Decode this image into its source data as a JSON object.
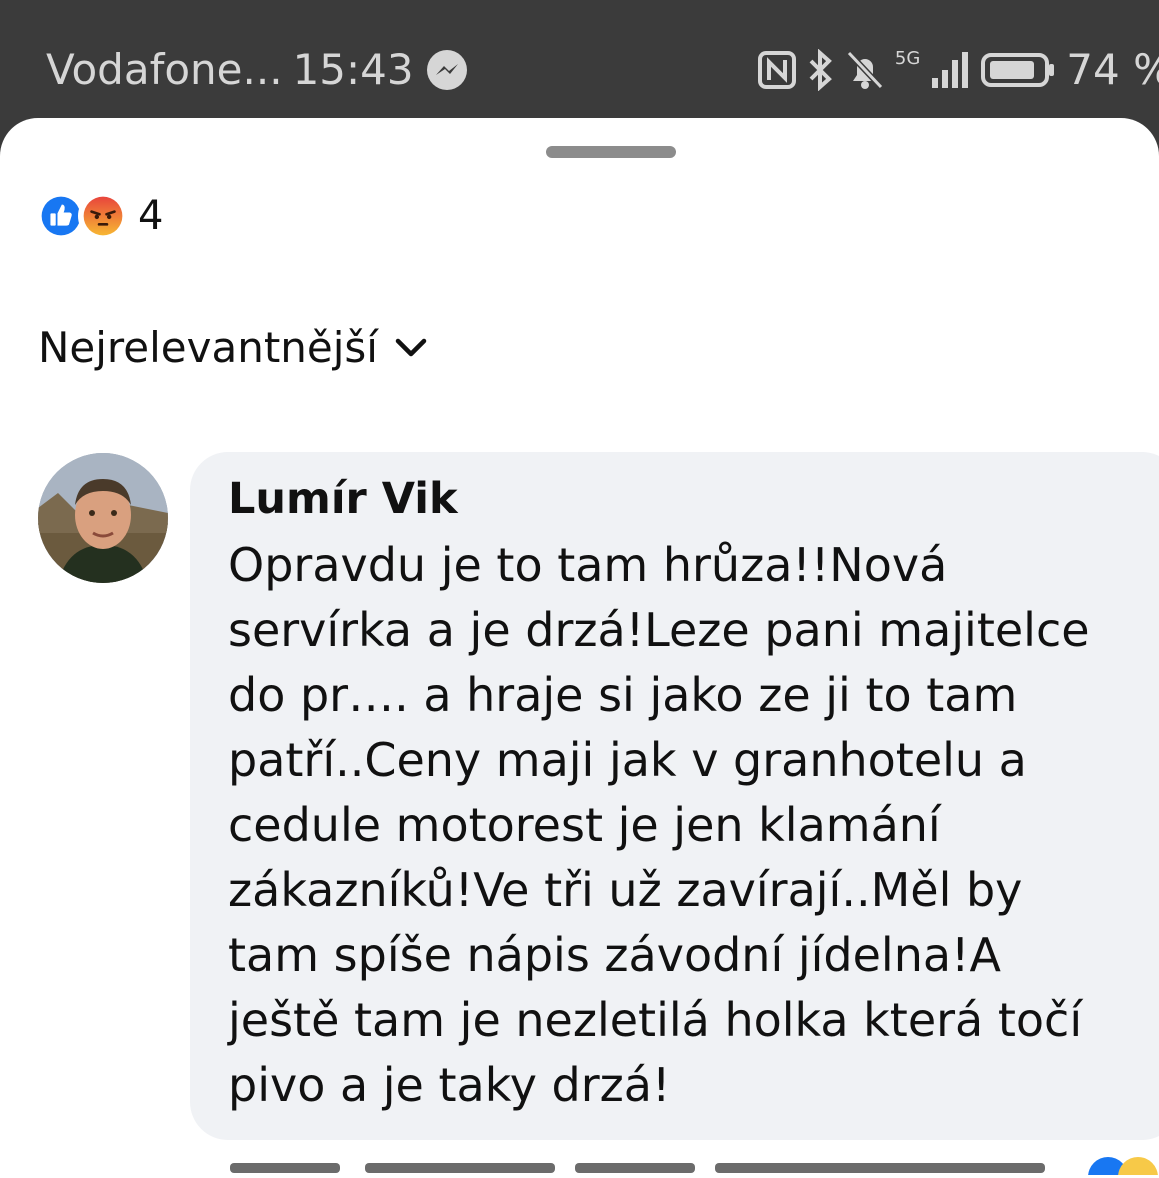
{
  "status_bar": {
    "carrier": "Vodafone...",
    "time": "15:43",
    "network": "5G",
    "battery": "74 %",
    "icons": [
      "messenger-icon",
      "nfc-icon",
      "bluetooth-icon",
      "bell-muted-icon",
      "signal-icon",
      "battery-icon"
    ]
  },
  "reactions": {
    "types": [
      "like",
      "angry"
    ],
    "count": "4",
    "colors": {
      "like": "#1877f2",
      "angry": "#f05a3a"
    }
  },
  "sort": {
    "label": "Nejrelevantnější"
  },
  "comment": {
    "author": "Lumír Vik",
    "text_lines": [
      "Opravdu je to tam hrůza!!Nová",
      "servírka a je drzá!Leze pani majitelce",
      "do pr…. a hraje si jako ze ji to tam",
      "patří..Ceny maji jak v granhotelu a",
      "cedule motorest je jen klamání",
      "zákazníků!Ve tři už zavírají..Měl by",
      "tam spíše nápis závodní jídelna!A",
      "ještě tam je nezletilá holka která točí",
      "pivo a je taky drzá!"
    ]
  },
  "colors": {
    "status_bar": "#3b3b3b",
    "sheet": "#ffffff",
    "bubble": "#f0f2f5",
    "text": "#111111"
  }
}
